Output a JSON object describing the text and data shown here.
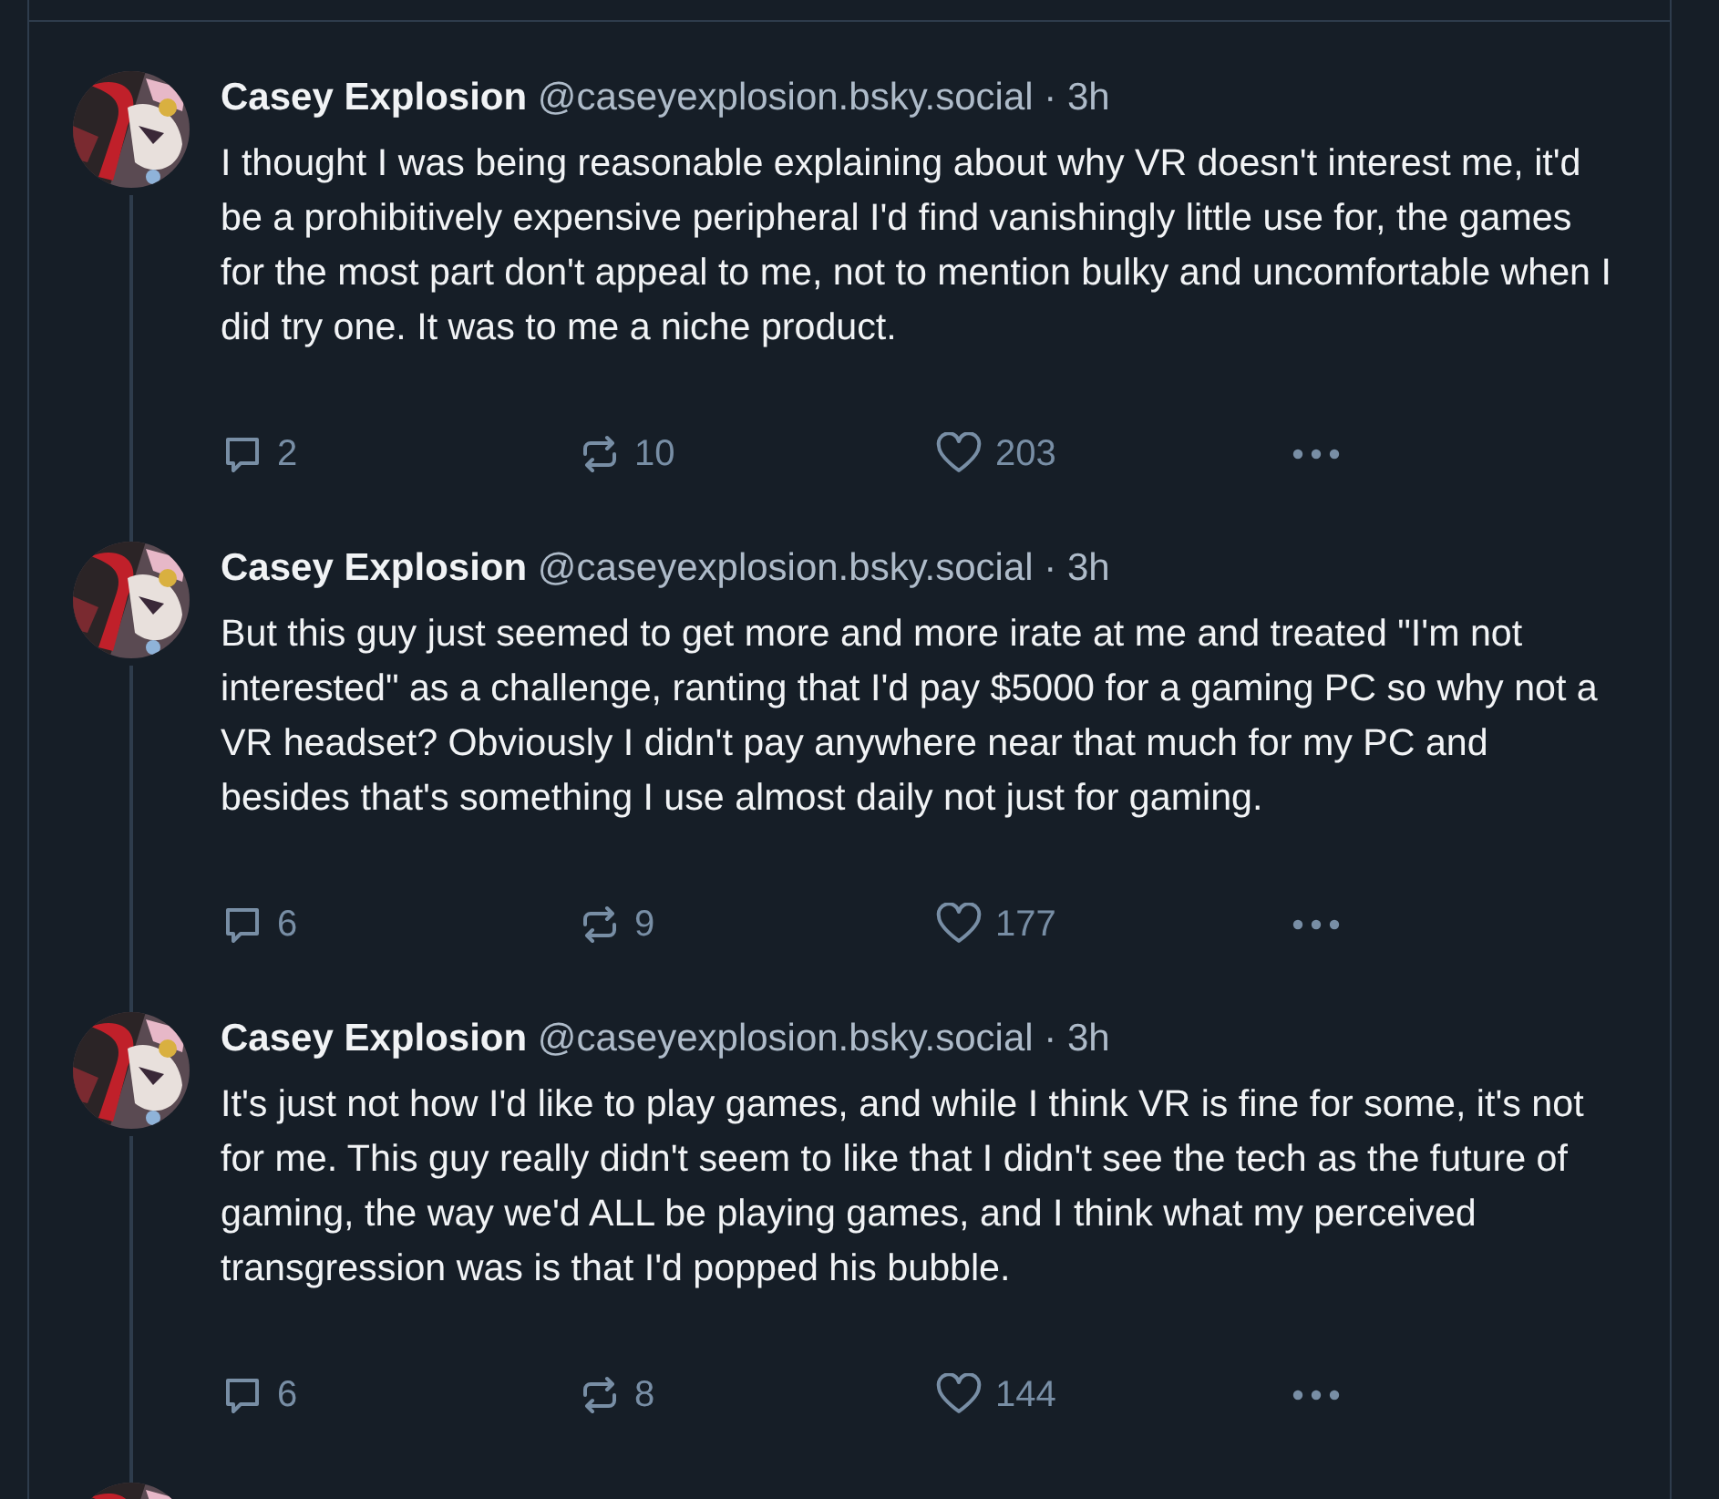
{
  "posts": [
    {
      "author": "Casey Explosion",
      "handle": "@caseyexplosion.bsky.social",
      "separator": "·",
      "time": "3h",
      "text": "I thought I was being reasonable explaining about why VR doesn't interest me, it'd be a prohibitively expensive peripheral I'd find vanishingly little use for, the games for the most part don't appeal to me, not to mention bulky and uncomfortable when I did try one. It was to me a niche product.",
      "replies": "2",
      "reposts": "10",
      "likes": "203"
    },
    {
      "author": "Casey Explosion",
      "handle": "@caseyexplosion.bsky.social",
      "separator": "·",
      "time": "3h",
      "text": "But this guy just seemed to get more and more irate at me and treated \"I'm not interested\" as a challenge, ranting that I'd pay $5000 for a gaming PC so why not a VR headset? Obviously I didn't pay anywhere near that much for my PC and besides that's something I use almost daily not just for gaming.",
      "replies": "6",
      "reposts": "9",
      "likes": "177"
    },
    {
      "author": "Casey Explosion",
      "handle": "@caseyexplosion.bsky.social",
      "separator": "·",
      "time": "3h",
      "text": "It's just not how I'd like to play games, and while I think VR is fine for some, it's not for me. This guy really didn't seem to like that I didn't see the tech as the future of gaming, the way we'd ALL be playing games, and I think what my perceived transgression was is that I'd popped his bubble.",
      "replies": "6",
      "reposts": "8",
      "likes": "144"
    }
  ]
}
